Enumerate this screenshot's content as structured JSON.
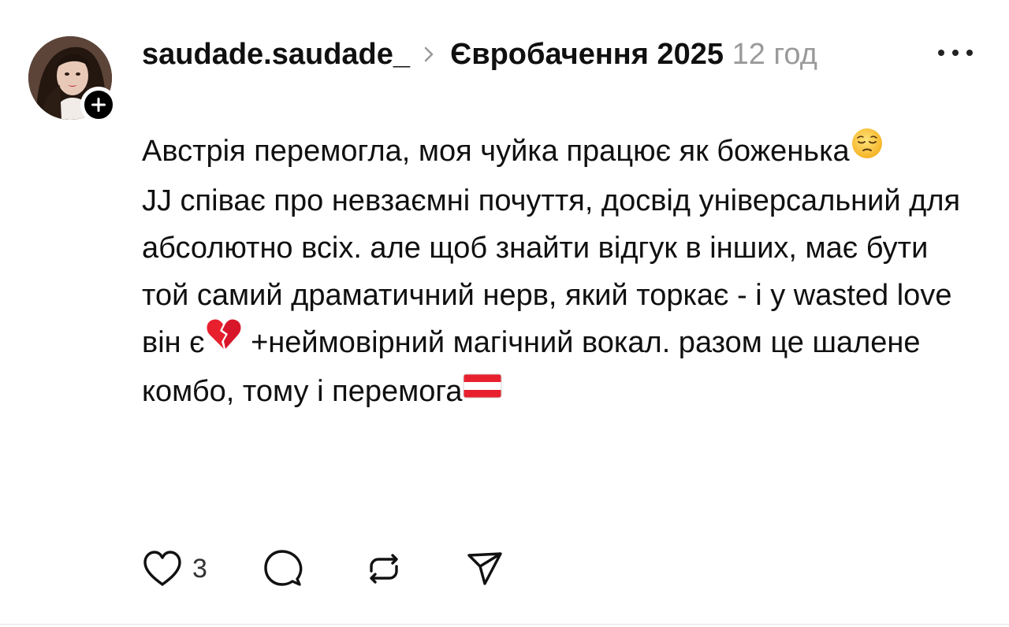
{
  "post": {
    "username": "saudade.saudade_",
    "topic": "Євробачення 2025",
    "time": "12 год",
    "paragraph1": "Австрія перемогла, моя чуйка працює як боженька",
    "paragraph1_emoji": "pensive-face-emoji",
    "paragraph2_part1": "JJ співає про невзаємні почуття, досвід універсальний для абсолютно всіх. але щоб знайти відгук в інших, має бути той самий драматичний нерв, який торкає - і у wasted love він є",
    "paragraph2_part2": " +неймовірний магічний вокал. разом це шалене комбо, тому і перемога",
    "paragraph2_emoji1": "broken-heart-emoji",
    "paragraph2_emoji2": "austria-flag-emoji"
  },
  "actions": {
    "like_count": "3",
    "like_icon": "heart-icon",
    "comment_icon": "comment-icon",
    "repost_icon": "repost-icon",
    "share_icon": "send-icon"
  },
  "colors": {
    "text": "#101010",
    "muted": "#9a9a9a",
    "badge": "#000000"
  }
}
